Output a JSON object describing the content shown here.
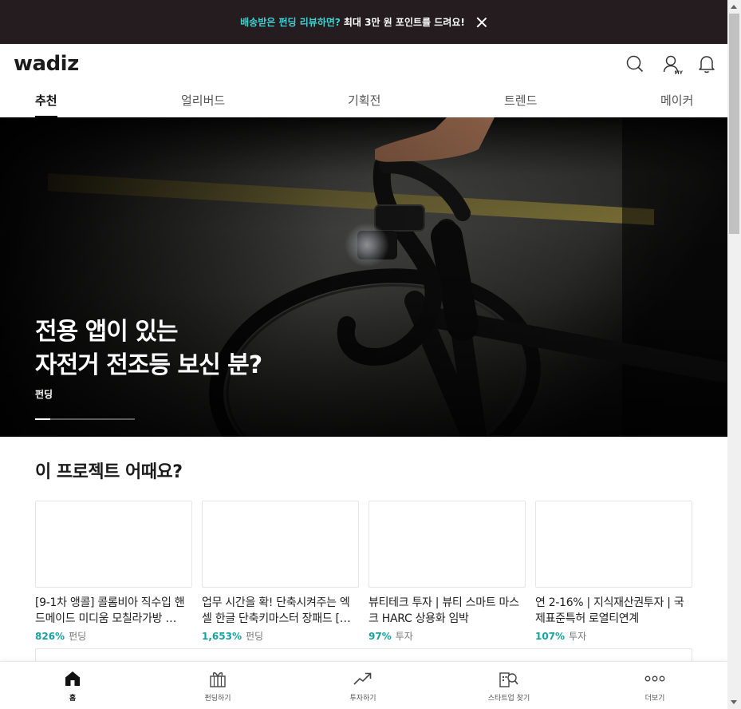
{
  "promo": {
    "highlight": "배송받은 펀딩 리뷰하면?",
    "text": "최대 3만 원 포인트를 드려요!"
  },
  "header": {
    "logo": "wadiz",
    "my_label": "MY",
    "icons": [
      "search-icon",
      "user-icon",
      "bell-icon"
    ]
  },
  "tabs": [
    {
      "label": "추천",
      "active": true
    },
    {
      "label": "얼리버드",
      "active": false
    },
    {
      "label": "기획전",
      "active": false
    },
    {
      "label": "트렌드",
      "active": false
    },
    {
      "label": "메이커",
      "active": false
    }
  ],
  "hero": {
    "title_line1": "전용 앱이 있는",
    "title_line2": "자전거 전조등 보신 분?",
    "category": "펀딩",
    "progress_fraction": 0.15
  },
  "section": {
    "title": "이 프로젝트 어때요?",
    "cards": [
      {
        "title": "[9-1차 앵콜] 콜롬비아 직수입 핸드메이드 미디움 모칠라가방 …",
        "percent": "826%",
        "type": "펀딩"
      },
      {
        "title": "업무 시간을 확! 단축시켜주는 엑셀 한글 단축키마스터 장패드 […",
        "percent": "1,653%",
        "type": "펀딩"
      },
      {
        "title": "뷰티테크 투자 | 뷰티 스마트 마스크 HARC 상용화 임박",
        "percent": "97%",
        "type": "투자"
      },
      {
        "title": "연 2-16% | 지식재산권투자 | 국제표준특허 로열티연계",
        "percent": "107%",
        "type": "투자"
      }
    ]
  },
  "bottom_nav": [
    {
      "label": "홈",
      "icon": "home-icon",
      "active": true
    },
    {
      "label": "펀딩하기",
      "icon": "gift-icon",
      "active": false
    },
    {
      "label": "투자하기",
      "icon": "trend-up-icon",
      "active": false
    },
    {
      "label": "스타트업 찾기",
      "icon": "building-search-icon",
      "active": false
    },
    {
      "label": "더보기",
      "icon": "more-dots-icon",
      "active": false
    }
  ],
  "colors": {
    "promo_bg": "#241c1e",
    "promo_highlight": "#3fd0d0",
    "percent": "#17a2a2"
  }
}
